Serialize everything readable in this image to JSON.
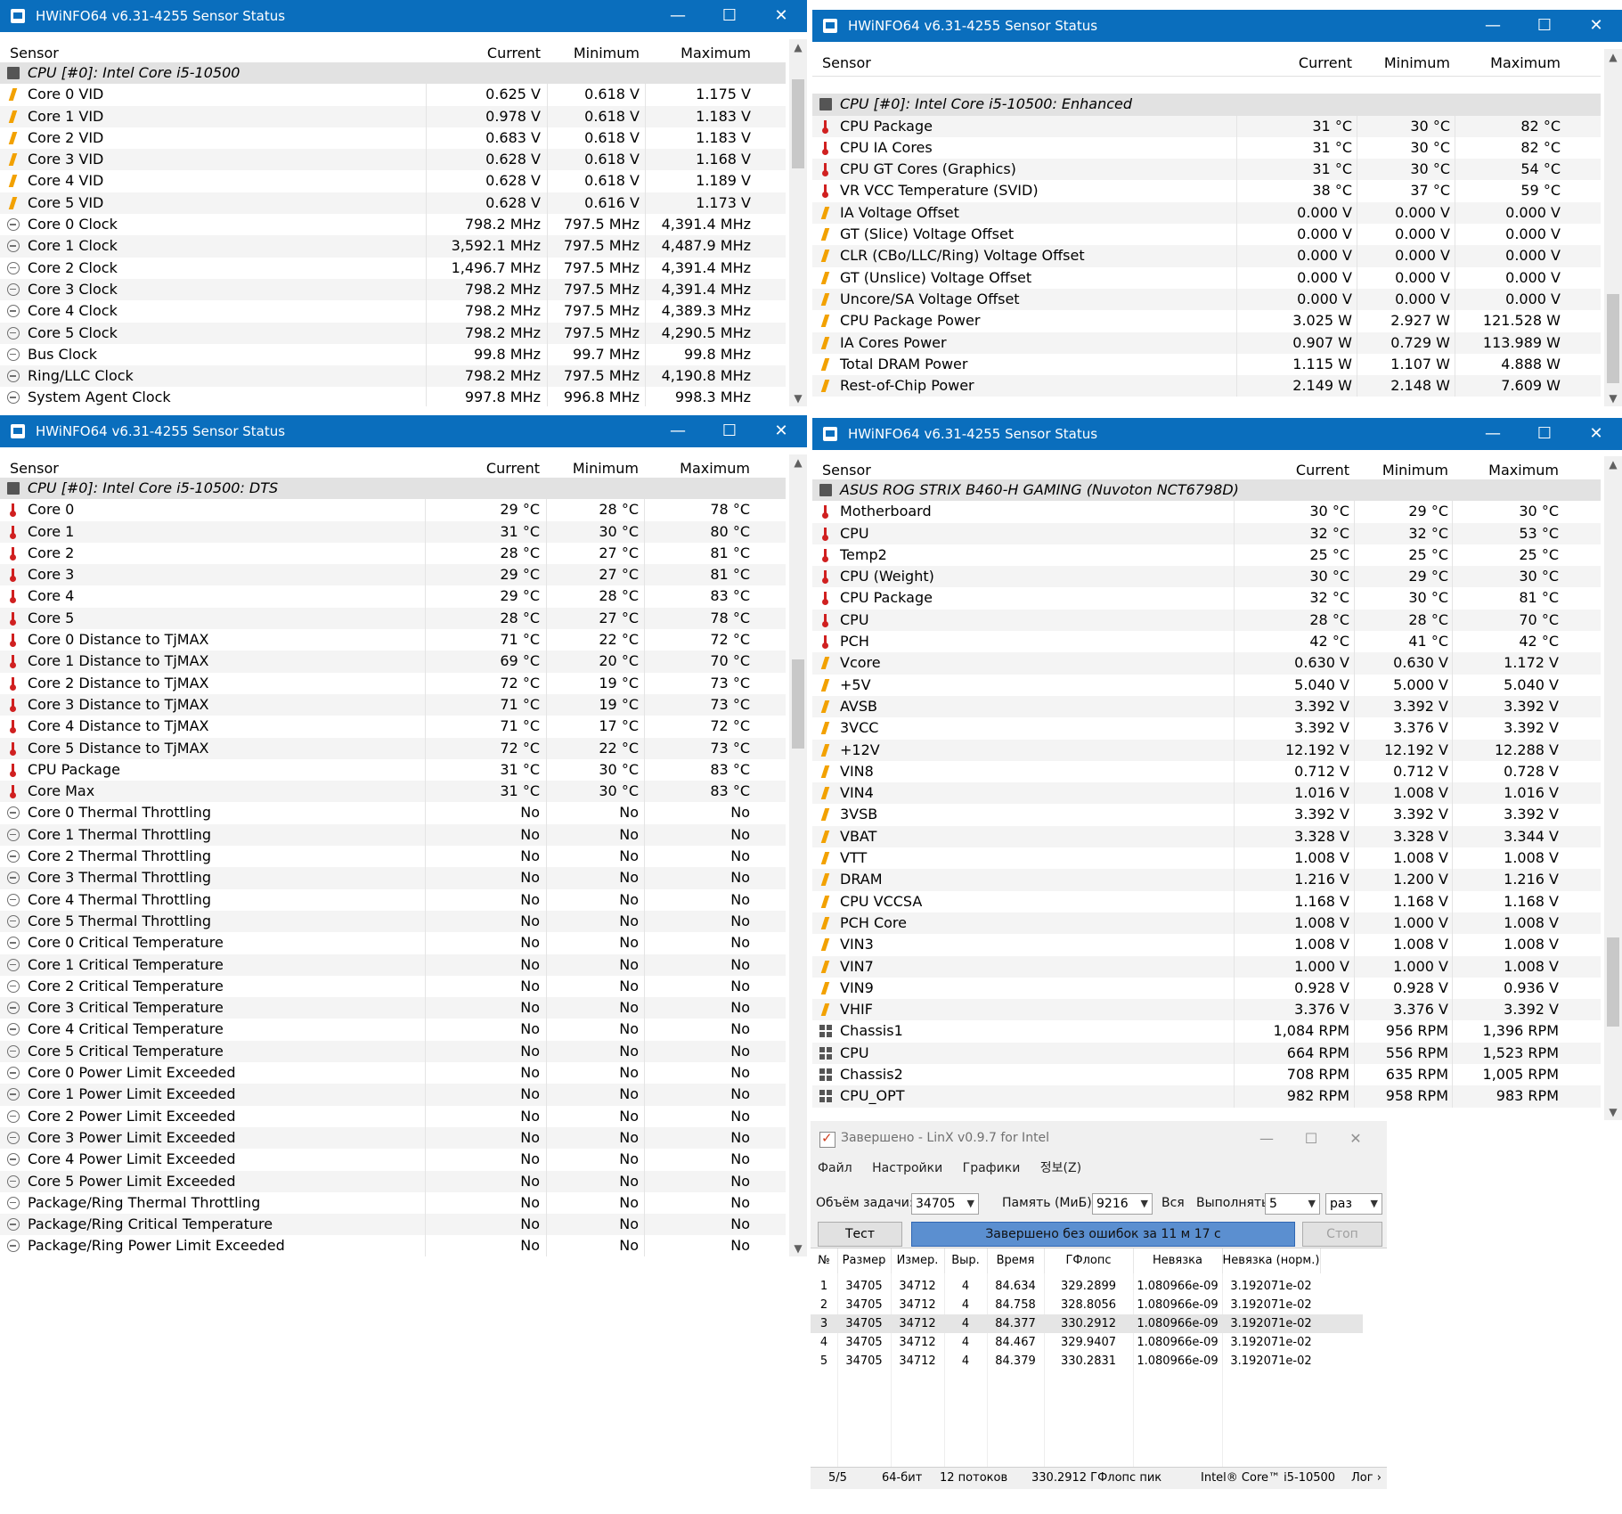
{
  "colors": {
    "titlebar": "#0a6ebd",
    "progress": "#5b8fd0",
    "voltage_icon": "#f2a100",
    "temp_icon": "#d02020"
  },
  "window_controls": {
    "minimize": "—",
    "maximize": "☐",
    "close": "✕"
  },
  "columns": {
    "sensor": "Sensor",
    "current": "Current",
    "minimum": "Minimum",
    "maximum": "Maximum"
  },
  "windows": [
    {
      "title": "HWiNFO64 v6.31-4255 Sensor Status",
      "rows": [
        {
          "type": "group",
          "icon": "chip-icon",
          "name": "CPU [#0]: Intel Core i5-10500"
        },
        {
          "icon": "volt",
          "name": "Core 0 VID",
          "cur": "0.625 V",
          "min": "0.618 V",
          "max": "1.175 V"
        },
        {
          "icon": "volt",
          "name": "Core 1 VID",
          "cur": "0.978 V",
          "min": "0.618 V",
          "max": "1.183 V"
        },
        {
          "icon": "volt",
          "name": "Core 2 VID",
          "cur": "0.683 V",
          "min": "0.618 V",
          "max": "1.183 V"
        },
        {
          "icon": "volt",
          "name": "Core 3 VID",
          "cur": "0.628 V",
          "min": "0.618 V",
          "max": "1.168 V"
        },
        {
          "icon": "volt",
          "name": "Core 4 VID",
          "cur": "0.628 V",
          "min": "0.618 V",
          "max": "1.189 V"
        },
        {
          "icon": "volt",
          "name": "Core 5 VID",
          "cur": "0.628 V",
          "min": "0.616 V",
          "max": "1.173 V"
        },
        {
          "icon": "clock",
          "name": "Core 0 Clock",
          "cur": "798.2 MHz",
          "min": "797.5 MHz",
          "max": "4,391.4 MHz"
        },
        {
          "icon": "clock",
          "name": "Core 1 Clock",
          "cur": "3,592.1 MHz",
          "min": "797.5 MHz",
          "max": "4,487.9 MHz"
        },
        {
          "icon": "clock",
          "name": "Core 2 Clock",
          "cur": "1,496.7 MHz",
          "min": "797.5 MHz",
          "max": "4,391.4 MHz"
        },
        {
          "icon": "clock",
          "name": "Core 3 Clock",
          "cur": "798.2 MHz",
          "min": "797.5 MHz",
          "max": "4,391.4 MHz"
        },
        {
          "icon": "clock",
          "name": "Core 4 Clock",
          "cur": "798.2 MHz",
          "min": "797.5 MHz",
          "max": "4,389.3 MHz"
        },
        {
          "icon": "clock",
          "name": "Core 5 Clock",
          "cur": "798.2 MHz",
          "min": "797.5 MHz",
          "max": "4,290.5 MHz"
        },
        {
          "icon": "clock",
          "name": "Bus Clock",
          "cur": "99.8 MHz",
          "min": "99.7 MHz",
          "max": "99.8 MHz"
        },
        {
          "icon": "clock",
          "name": "Ring/LLC Clock",
          "cur": "798.2 MHz",
          "min": "797.5 MHz",
          "max": "4,190.8 MHz"
        },
        {
          "icon": "clock",
          "name": "System Agent Clock",
          "cur": "997.8 MHz",
          "min": "996.8 MHz",
          "max": "998.3 MHz"
        }
      ]
    },
    {
      "title": "HWiNFO64 v6.31-4255 Sensor Status",
      "rows": [
        {
          "type": "blank"
        },
        {
          "type": "group",
          "icon": "chip-icon",
          "name": "CPU [#0]: Intel Core i5-10500: Enhanced"
        },
        {
          "icon": "temp",
          "name": "CPU Package",
          "cur": "31 °C",
          "min": "30 °C",
          "max": "82 °C"
        },
        {
          "icon": "temp",
          "name": "CPU IA Cores",
          "cur": "31 °C",
          "min": "30 °C",
          "max": "82 °C"
        },
        {
          "icon": "temp",
          "name": "CPU GT Cores (Graphics)",
          "cur": "31 °C",
          "min": "30 °C",
          "max": "54 °C"
        },
        {
          "icon": "temp",
          "name": "VR VCC Temperature (SVID)",
          "cur": "38 °C",
          "min": "37 °C",
          "max": "59 °C"
        },
        {
          "icon": "volt",
          "name": "IA Voltage Offset",
          "cur": "0.000 V",
          "min": "0.000 V",
          "max": "0.000 V"
        },
        {
          "icon": "volt",
          "name": "GT (Slice) Voltage Offset",
          "cur": "0.000 V",
          "min": "0.000 V",
          "max": "0.000 V"
        },
        {
          "icon": "volt",
          "name": "CLR (CBo/LLC/Ring) Voltage Offset",
          "cur": "0.000 V",
          "min": "0.000 V",
          "max": "0.000 V"
        },
        {
          "icon": "volt",
          "name": "GT (Unslice) Voltage Offset",
          "cur": "0.000 V",
          "min": "0.000 V",
          "max": "0.000 V"
        },
        {
          "icon": "volt",
          "name": "Uncore/SA Voltage Offset",
          "cur": "0.000 V",
          "min": "0.000 V",
          "max": "0.000 V"
        },
        {
          "icon": "volt",
          "name": "CPU Package Power",
          "cur": "3.025 W",
          "min": "2.927 W",
          "max": "121.528 W"
        },
        {
          "icon": "volt",
          "name": "IA Cores Power",
          "cur": "0.907 W",
          "min": "0.729 W",
          "max": "113.989 W"
        },
        {
          "icon": "volt",
          "name": "Total DRAM Power",
          "cur": "1.115 W",
          "min": "1.107 W",
          "max": "4.888 W"
        },
        {
          "icon": "volt",
          "name": "Rest-of-Chip Power",
          "cur": "2.149 W",
          "min": "2.148 W",
          "max": "7.609 W"
        }
      ]
    },
    {
      "title": "HWiNFO64 v6.31-4255 Sensor Status",
      "rows": [
        {
          "type": "group",
          "icon": "chip-icon",
          "name": "CPU [#0]: Intel Core i5-10500: DTS"
        },
        {
          "icon": "temp",
          "name": "Core 0",
          "cur": "29 °C",
          "min": "28 °C",
          "max": "78 °C"
        },
        {
          "icon": "temp",
          "name": "Core 1",
          "cur": "31 °C",
          "min": "30 °C",
          "max": "80 °C"
        },
        {
          "icon": "temp",
          "name": "Core 2",
          "cur": "28 °C",
          "min": "27 °C",
          "max": "81 °C"
        },
        {
          "icon": "temp",
          "name": "Core 3",
          "cur": "29 °C",
          "min": "27 °C",
          "max": "81 °C"
        },
        {
          "icon": "temp",
          "name": "Core 4",
          "cur": "29 °C",
          "min": "28 °C",
          "max": "83 °C"
        },
        {
          "icon": "temp",
          "name": "Core 5",
          "cur": "28 °C",
          "min": "27 °C",
          "max": "78 °C"
        },
        {
          "icon": "temp",
          "name": "Core 0 Distance to TjMAX",
          "cur": "71 °C",
          "min": "22 °C",
          "max": "72 °C"
        },
        {
          "icon": "temp",
          "name": "Core 1 Distance to TjMAX",
          "cur": "69 °C",
          "min": "20 °C",
          "max": "70 °C"
        },
        {
          "icon": "temp",
          "name": "Core 2 Distance to TjMAX",
          "cur": "72 °C",
          "min": "19 °C",
          "max": "73 °C"
        },
        {
          "icon": "temp",
          "name": "Core 3 Distance to TjMAX",
          "cur": "71 °C",
          "min": "19 °C",
          "max": "73 °C"
        },
        {
          "icon": "temp",
          "name": "Core 4 Distance to TjMAX",
          "cur": "71 °C",
          "min": "17 °C",
          "max": "72 °C"
        },
        {
          "icon": "temp",
          "name": "Core 5 Distance to TjMAX",
          "cur": "72 °C",
          "min": "22 °C",
          "max": "73 °C"
        },
        {
          "icon": "temp",
          "name": "CPU Package",
          "cur": "31 °C",
          "min": "30 °C",
          "max": "83 °C"
        },
        {
          "icon": "temp",
          "name": "Core Max",
          "cur": "31 °C",
          "min": "30 °C",
          "max": "83 °C"
        },
        {
          "icon": "clock",
          "name": "Core 0 Thermal Throttling",
          "cur": "No",
          "min": "No",
          "max": "No"
        },
        {
          "icon": "clock",
          "name": "Core 1 Thermal Throttling",
          "cur": "No",
          "min": "No",
          "max": "No"
        },
        {
          "icon": "clock",
          "name": "Core 2 Thermal Throttling",
          "cur": "No",
          "min": "No",
          "max": "No"
        },
        {
          "icon": "clock",
          "name": "Core 3 Thermal Throttling",
          "cur": "No",
          "min": "No",
          "max": "No"
        },
        {
          "icon": "clock",
          "name": "Core 4 Thermal Throttling",
          "cur": "No",
          "min": "No",
          "max": "No"
        },
        {
          "icon": "clock",
          "name": "Core 5 Thermal Throttling",
          "cur": "No",
          "min": "No",
          "max": "No"
        },
        {
          "icon": "clock",
          "name": "Core 0 Critical Temperature",
          "cur": "No",
          "min": "No",
          "max": "No"
        },
        {
          "icon": "clock",
          "name": "Core 1 Critical Temperature",
          "cur": "No",
          "min": "No",
          "max": "No"
        },
        {
          "icon": "clock",
          "name": "Core 2 Critical Temperature",
          "cur": "No",
          "min": "No",
          "max": "No"
        },
        {
          "icon": "clock",
          "name": "Core 3 Critical Temperature",
          "cur": "No",
          "min": "No",
          "max": "No"
        },
        {
          "icon": "clock",
          "name": "Core 4 Critical Temperature",
          "cur": "No",
          "min": "No",
          "max": "No"
        },
        {
          "icon": "clock",
          "name": "Core 5 Critical Temperature",
          "cur": "No",
          "min": "No",
          "max": "No"
        },
        {
          "icon": "clock",
          "name": "Core 0 Power Limit Exceeded",
          "cur": "No",
          "min": "No",
          "max": "No"
        },
        {
          "icon": "clock",
          "name": "Core 1 Power Limit Exceeded",
          "cur": "No",
          "min": "No",
          "max": "No"
        },
        {
          "icon": "clock",
          "name": "Core 2 Power Limit Exceeded",
          "cur": "No",
          "min": "No",
          "max": "No"
        },
        {
          "icon": "clock",
          "name": "Core 3 Power Limit Exceeded",
          "cur": "No",
          "min": "No",
          "max": "No"
        },
        {
          "icon": "clock",
          "name": "Core 4 Power Limit Exceeded",
          "cur": "No",
          "min": "No",
          "max": "No"
        },
        {
          "icon": "clock",
          "name": "Core 5 Power Limit Exceeded",
          "cur": "No",
          "min": "No",
          "max": "No"
        },
        {
          "icon": "clock",
          "name": "Package/Ring Thermal Throttling",
          "cur": "No",
          "min": "No",
          "max": "No"
        },
        {
          "icon": "clock",
          "name": "Package/Ring Critical Temperature",
          "cur": "No",
          "min": "No",
          "max": "No"
        },
        {
          "icon": "clock",
          "name": "Package/Ring Power Limit Exceeded",
          "cur": "No",
          "min": "No",
          "max": "No"
        }
      ]
    },
    {
      "title": "HWiNFO64 v6.31-4255 Sensor Status",
      "rows": [
        {
          "type": "group",
          "icon": "chip-icon",
          "name": "ASUS ROG STRIX B460-H GAMING (Nuvoton NCT6798D)"
        },
        {
          "icon": "temp",
          "name": "Motherboard",
          "cur": "30 °C",
          "min": "29 °C",
          "max": "30 °C"
        },
        {
          "icon": "temp",
          "name": "CPU",
          "cur": "32 °C",
          "min": "32 °C",
          "max": "53 °C"
        },
        {
          "icon": "temp",
          "name": "Temp2",
          "cur": "25 °C",
          "min": "25 °C",
          "max": "25 °C"
        },
        {
          "icon": "temp",
          "name": "CPU (Weight)",
          "cur": "30 °C",
          "min": "29 °C",
          "max": "30 °C"
        },
        {
          "icon": "temp",
          "name": "CPU Package",
          "cur": "32 °C",
          "min": "30 °C",
          "max": "81 °C"
        },
        {
          "icon": "temp",
          "name": "CPU",
          "cur": "28 °C",
          "min": "28 °C",
          "max": "70 °C"
        },
        {
          "icon": "temp",
          "name": "PCH",
          "cur": "42 °C",
          "min": "41 °C",
          "max": "42 °C"
        },
        {
          "icon": "volt",
          "name": "Vcore",
          "cur": "0.630 V",
          "min": "0.630 V",
          "max": "1.172 V"
        },
        {
          "icon": "volt",
          "name": "+5V",
          "cur": "5.040 V",
          "min": "5.000 V",
          "max": "5.040 V"
        },
        {
          "icon": "volt",
          "name": "AVSB",
          "cur": "3.392 V",
          "min": "3.392 V",
          "max": "3.392 V"
        },
        {
          "icon": "volt",
          "name": "3VCC",
          "cur": "3.392 V",
          "min": "3.376 V",
          "max": "3.392 V"
        },
        {
          "icon": "volt",
          "name": "+12V",
          "cur": "12.192 V",
          "min": "12.192 V",
          "max": "12.288 V"
        },
        {
          "icon": "volt",
          "name": "VIN8",
          "cur": "0.712 V",
          "min": "0.712 V",
          "max": "0.728 V"
        },
        {
          "icon": "volt",
          "name": "VIN4",
          "cur": "1.016 V",
          "min": "1.008 V",
          "max": "1.016 V"
        },
        {
          "icon": "volt",
          "name": "3VSB",
          "cur": "3.392 V",
          "min": "3.392 V",
          "max": "3.392 V"
        },
        {
          "icon": "volt",
          "name": "VBAT",
          "cur": "3.328 V",
          "min": "3.328 V",
          "max": "3.344 V"
        },
        {
          "icon": "volt",
          "name": "VTT",
          "cur": "1.008 V",
          "min": "1.008 V",
          "max": "1.008 V"
        },
        {
          "icon": "volt",
          "name": "DRAM",
          "cur": "1.216 V",
          "min": "1.200 V",
          "max": "1.216 V"
        },
        {
          "icon": "volt",
          "name": "CPU VCCSA",
          "cur": "1.168 V",
          "min": "1.168 V",
          "max": "1.168 V"
        },
        {
          "icon": "volt",
          "name": "PCH Core",
          "cur": "1.008 V",
          "min": "1.000 V",
          "max": "1.008 V"
        },
        {
          "icon": "volt",
          "name": "VIN3",
          "cur": "1.008 V",
          "min": "1.008 V",
          "max": "1.008 V"
        },
        {
          "icon": "volt",
          "name": "VIN7",
          "cur": "1.000 V",
          "min": "1.000 V",
          "max": "1.008 V"
        },
        {
          "icon": "volt",
          "name": "VIN9",
          "cur": "0.928 V",
          "min": "0.928 V",
          "max": "0.936 V"
        },
        {
          "icon": "volt",
          "name": "VHIF",
          "cur": "3.376 V",
          "min": "3.376 V",
          "max": "3.392 V"
        },
        {
          "icon": "fan",
          "name": "Chassis1",
          "cur": "1,084 RPM",
          "min": "956 RPM",
          "max": "1,396 RPM"
        },
        {
          "icon": "fan",
          "name": "CPU",
          "cur": "664 RPM",
          "min": "556 RPM",
          "max": "1,523 RPM"
        },
        {
          "icon": "fan",
          "name": "Chassis2",
          "cur": "708 RPM",
          "min": "635 RPM",
          "max": "1,005 RPM"
        },
        {
          "icon": "fan",
          "name": "CPU_OPT",
          "cur": "982 RPM",
          "min": "958 RPM",
          "max": "983 RPM"
        }
      ]
    }
  ],
  "linx": {
    "title": "Завершено - LinX v0.9.7 for Intel",
    "menu": [
      "Файл",
      "Настройки",
      "Графики",
      "정보(Z)"
    ],
    "problem_size_label": "Объём задачи:",
    "problem_size_value": "34705",
    "memory_label": "Память (МиБ):",
    "memory_value": "9216",
    "all_label": "Вся",
    "run_label": "Выполнять:",
    "run_value": "5",
    "run_unit": "раз",
    "test_button": "Тест",
    "progress_text": "Завершено без ошибок за 11 м 17 с",
    "progress_fraction": 1.0,
    "stop_button": "Стоп",
    "headers": [
      "№",
      "Размер",
      "Измер.",
      "Выр.",
      "Время",
      "ГФлопс",
      "Невязка",
      "Невязка (норм.)"
    ],
    "rows": [
      [
        "1",
        "34705",
        "34712",
        "4",
        "84.634",
        "329.2899",
        "1.080966e-09",
        "3.192071e-02"
      ],
      [
        "2",
        "34705",
        "34712",
        "4",
        "84.758",
        "328.8056",
        "1.080966e-09",
        "3.192071e-02"
      ],
      [
        "3",
        "34705",
        "34712",
        "4",
        "84.377",
        "330.2912",
        "1.080966e-09",
        "3.192071e-02"
      ],
      [
        "4",
        "34705",
        "34712",
        "4",
        "84.467",
        "329.9407",
        "1.080966e-09",
        "3.192071e-02"
      ],
      [
        "5",
        "34705",
        "34712",
        "4",
        "84.379",
        "330.2831",
        "1.080966e-09",
        "3.192071e-02"
      ]
    ],
    "selected_row": 3,
    "status": [
      "5/5",
      "64-бит",
      "12 потоков",
      "330.2912 ГФлопс пик",
      "Intel® Core™ i5-10500",
      "Лог ›"
    ]
  }
}
